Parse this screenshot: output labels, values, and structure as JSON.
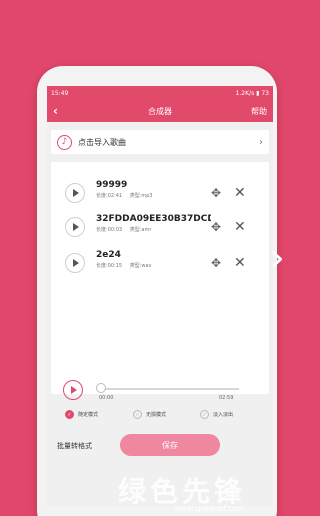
{
  "status_bar": {
    "time": "15:49",
    "network": "1.2K/s",
    "battery": "73"
  },
  "nav": {
    "back_icon": "chevron-left-icon",
    "title": "合成器",
    "help_label": "帮助"
  },
  "import": {
    "label": "点击导入歌曲"
  },
  "tracks": [
    {
      "name": "99999",
      "length_label": "长度:02:41",
      "type_label": "类型:mp3"
    },
    {
      "name": "32FDDA09EE30B37DCD5...",
      "length_label": "长度:00:03",
      "type_label": "类型:amr"
    },
    {
      "name": "2e24",
      "length_label": "长度:00:15",
      "type_label": "类型:wav"
    }
  ],
  "player": {
    "start_time": "00:00",
    "end_time": "02:59",
    "progress": 0
  },
  "modes": [
    {
      "label": "随定模式",
      "selected": true
    },
    {
      "label": "无损模式",
      "selected": false
    },
    {
      "label": "淡入淡出",
      "selected": false
    }
  ],
  "bottom": {
    "batch_label": "批量转格式",
    "save_label": "保存"
  },
  "watermark": {
    "logo": "绿色先锋",
    "url": "www.greenxf.com"
  },
  "colors": {
    "accent": "#e24a6c",
    "background": "#e0476a",
    "save_button": "#f087a0"
  }
}
